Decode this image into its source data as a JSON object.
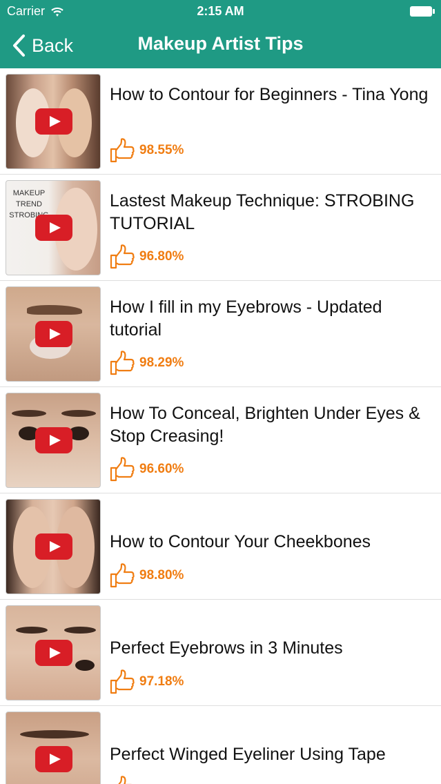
{
  "status_bar": {
    "carrier": "Carrier",
    "time": "2:15 AM"
  },
  "nav": {
    "back_label": "Back",
    "title": "Makeup Artist Tips"
  },
  "colors": {
    "header": "#1f9a84",
    "rating": "#f07d12",
    "play_button": "#d81e26"
  },
  "items": [
    {
      "title": "How to Contour for Beginners - Tina Yong",
      "rating": "98.55%"
    },
    {
      "title": "Lastest Makeup Technique: STROBING TUTORIAL",
      "rating": "96.80%",
      "thumb_text": "MAKEUP TREND STROBING"
    },
    {
      "title": "How I fill in my Eyebrows - Updated tutorial",
      "rating": "98.29%"
    },
    {
      "title": "How To Conceal, Brighten Under Eyes & Stop Creasing!",
      "rating": "96.60%"
    },
    {
      "title": "How to Contour Your Cheekbones",
      "rating": "98.80%"
    },
    {
      "title": "Perfect Eyebrows in 3 Minutes",
      "rating": "97.18%"
    },
    {
      "title": "Perfect Winged Eyeliner Using Tape",
      "rating": ""
    }
  ]
}
